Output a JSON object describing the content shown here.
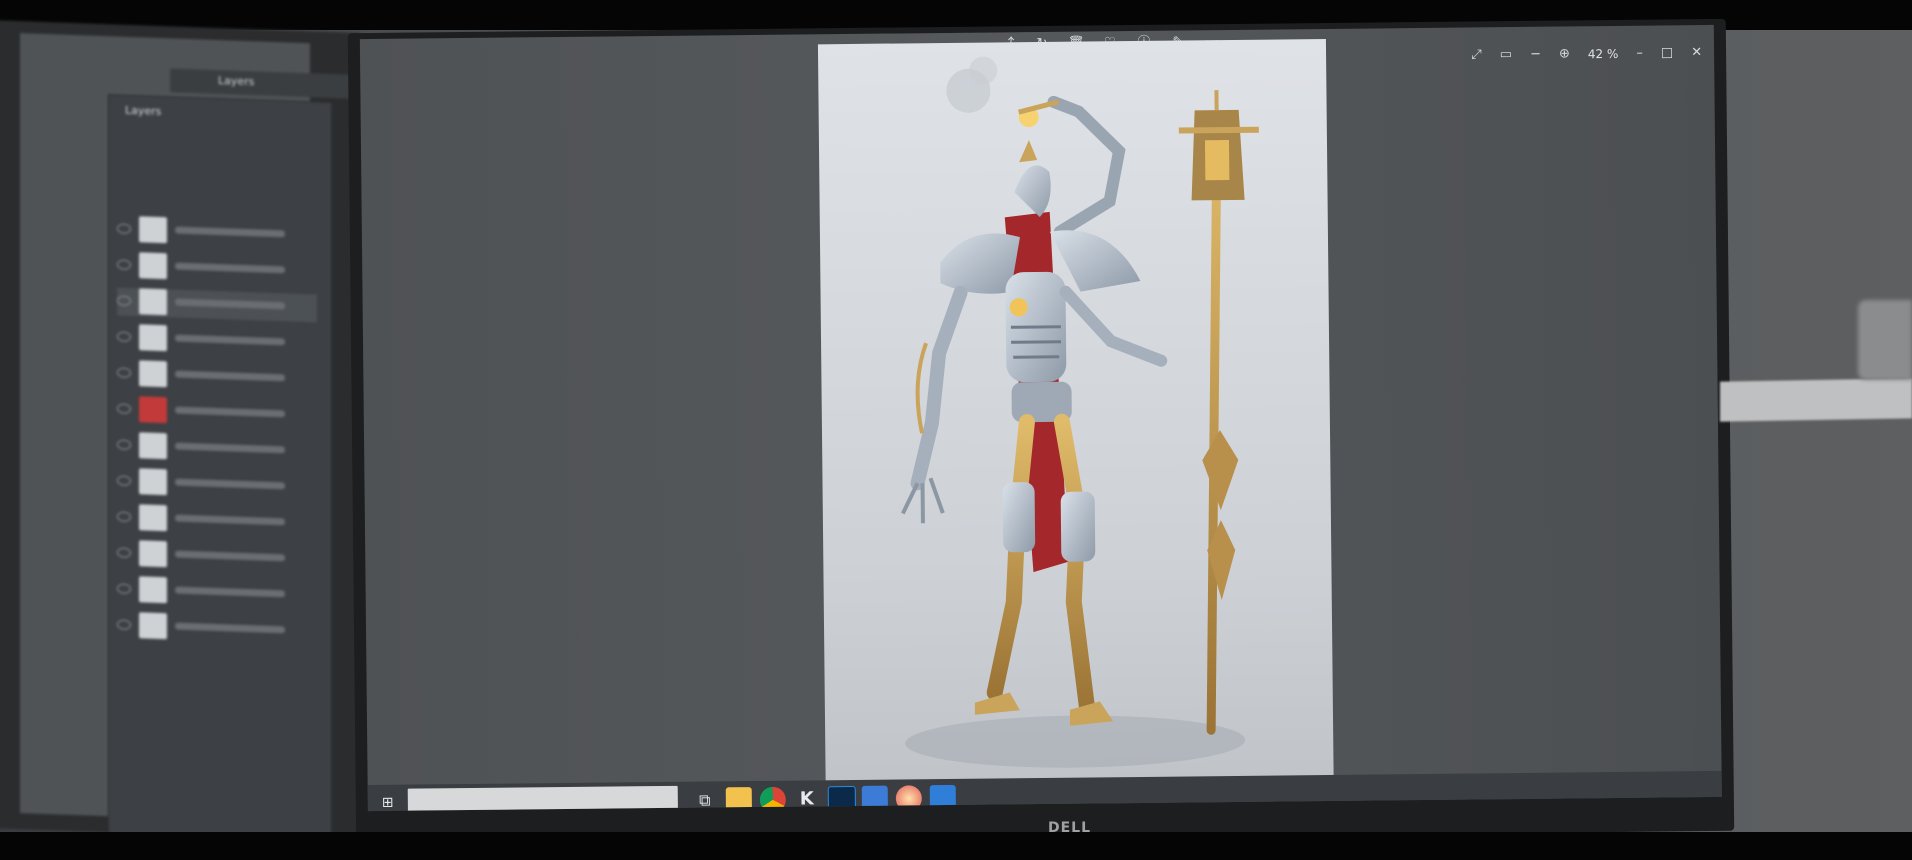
{
  "left_panel": {
    "title": "Layers",
    "header_tab": "Layers",
    "rows": [
      {
        "label": "",
        "thumb": "light"
      },
      {
        "label": "",
        "thumb": "light"
      },
      {
        "label": "",
        "thumb": "light"
      },
      {
        "label": "",
        "thumb": "light"
      },
      {
        "label": "",
        "thumb": "light"
      },
      {
        "label": "",
        "thumb": "red"
      },
      {
        "label": "",
        "thumb": "light"
      },
      {
        "label": "",
        "thumb": "light"
      },
      {
        "label": "",
        "thumb": "light"
      },
      {
        "label": "",
        "thumb": "light"
      },
      {
        "label": "",
        "thumb": "light"
      },
      {
        "label": "",
        "thumb": "light"
      }
    ]
  },
  "viewer": {
    "zoom": "42 %",
    "tools": [
      "share-icon",
      "rotate-icon",
      "delete-icon",
      "favorite-icon",
      "info-icon",
      "edit-icon",
      "more-icon"
    ],
    "window_controls": [
      "fullscreen-icon",
      "crop-icon",
      "zoom-out-icon",
      "zoom-in-icon",
      "minimize-icon",
      "maximize-icon",
      "close-icon"
    ]
  },
  "taskbar": {
    "search_placeholder": "",
    "apps": [
      "task-view-icon",
      "file-explorer-icon",
      "chrome-icon",
      "k-app-icon",
      "photoshop-icon",
      "tool-app-icon",
      "browser-app-icon",
      "photos-icon"
    ]
  },
  "monitor_brand": "DELL",
  "colors": {
    "accent": "#6fb2ff",
    "photoshop": "#2b8be3",
    "cloak": "#a3272b",
    "armor": "#b9c3cf",
    "gold": "#c49a4a"
  }
}
